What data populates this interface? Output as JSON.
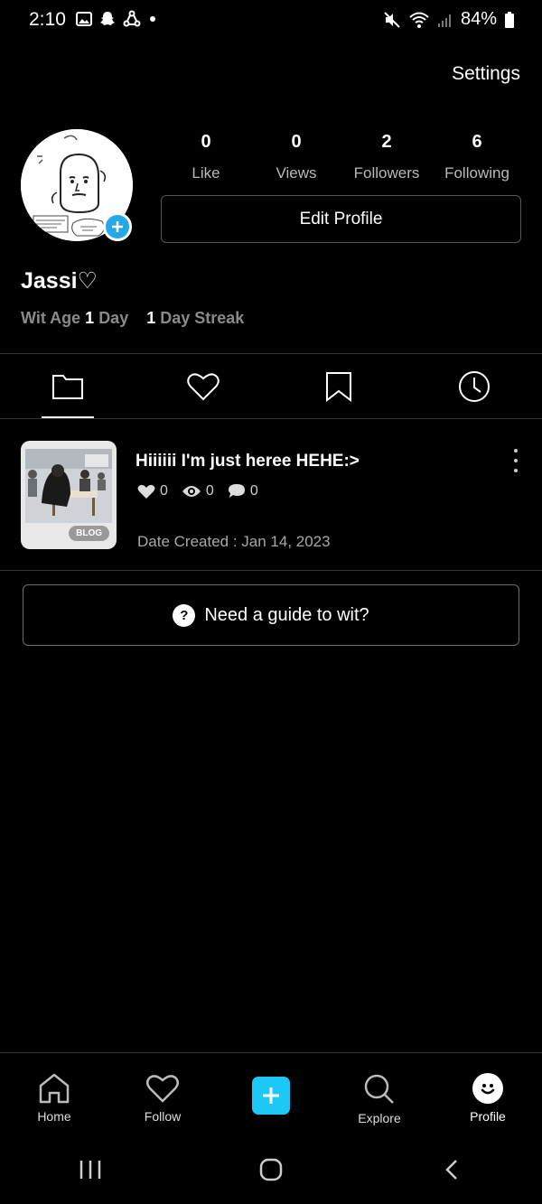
{
  "status_bar": {
    "time": "2:10",
    "battery": "84%",
    "left_icons": [
      "image-icon",
      "snapchat-icon",
      "share-icon",
      "dot-icon"
    ],
    "right_icons": [
      "mute-icon",
      "wifi-icon",
      "signal-icon",
      "battery-icon"
    ]
  },
  "header": {
    "settings_label": "Settings"
  },
  "profile": {
    "username": "Jassi♡",
    "wit_age_label": "Wit Age",
    "wit_age_value": "1",
    "wit_age_unit": "Day",
    "streak_value": "1",
    "streak_label": "Day Streak"
  },
  "stats": [
    {
      "value": "0",
      "label": "Like"
    },
    {
      "value": "0",
      "label": "Views"
    },
    {
      "value": "2",
      "label": "Followers"
    },
    {
      "value": "6",
      "label": "Following"
    }
  ],
  "edit_profile_label": "Edit Profile",
  "tabs": [
    {
      "icon": "folder-icon",
      "active": true
    },
    {
      "icon": "heart-icon",
      "active": false
    },
    {
      "icon": "bookmark-icon",
      "active": false
    },
    {
      "icon": "clock-icon",
      "active": false
    }
  ],
  "post": {
    "title": "Hiiiiii I'm just heree HEHE:>",
    "likes": "0",
    "views": "0",
    "comments": "0",
    "badge": "BLOG",
    "date": "Date Created : Jan 14, 2023"
  },
  "guide": {
    "icon_text": "?",
    "label": "Need a guide to wit?"
  },
  "bottom_nav": [
    {
      "label": "Home",
      "icon": "home-icon"
    },
    {
      "label": "Follow",
      "icon": "heart-icon"
    },
    {
      "label": "",
      "icon": "plus-icon"
    },
    {
      "label": "Explore",
      "icon": "search-icon"
    },
    {
      "label": "Profile",
      "icon": "smiley-icon"
    }
  ],
  "colors": {
    "accent": "#1ec8f6",
    "avatar_add": "#25a8ea",
    "background": "#000000"
  }
}
